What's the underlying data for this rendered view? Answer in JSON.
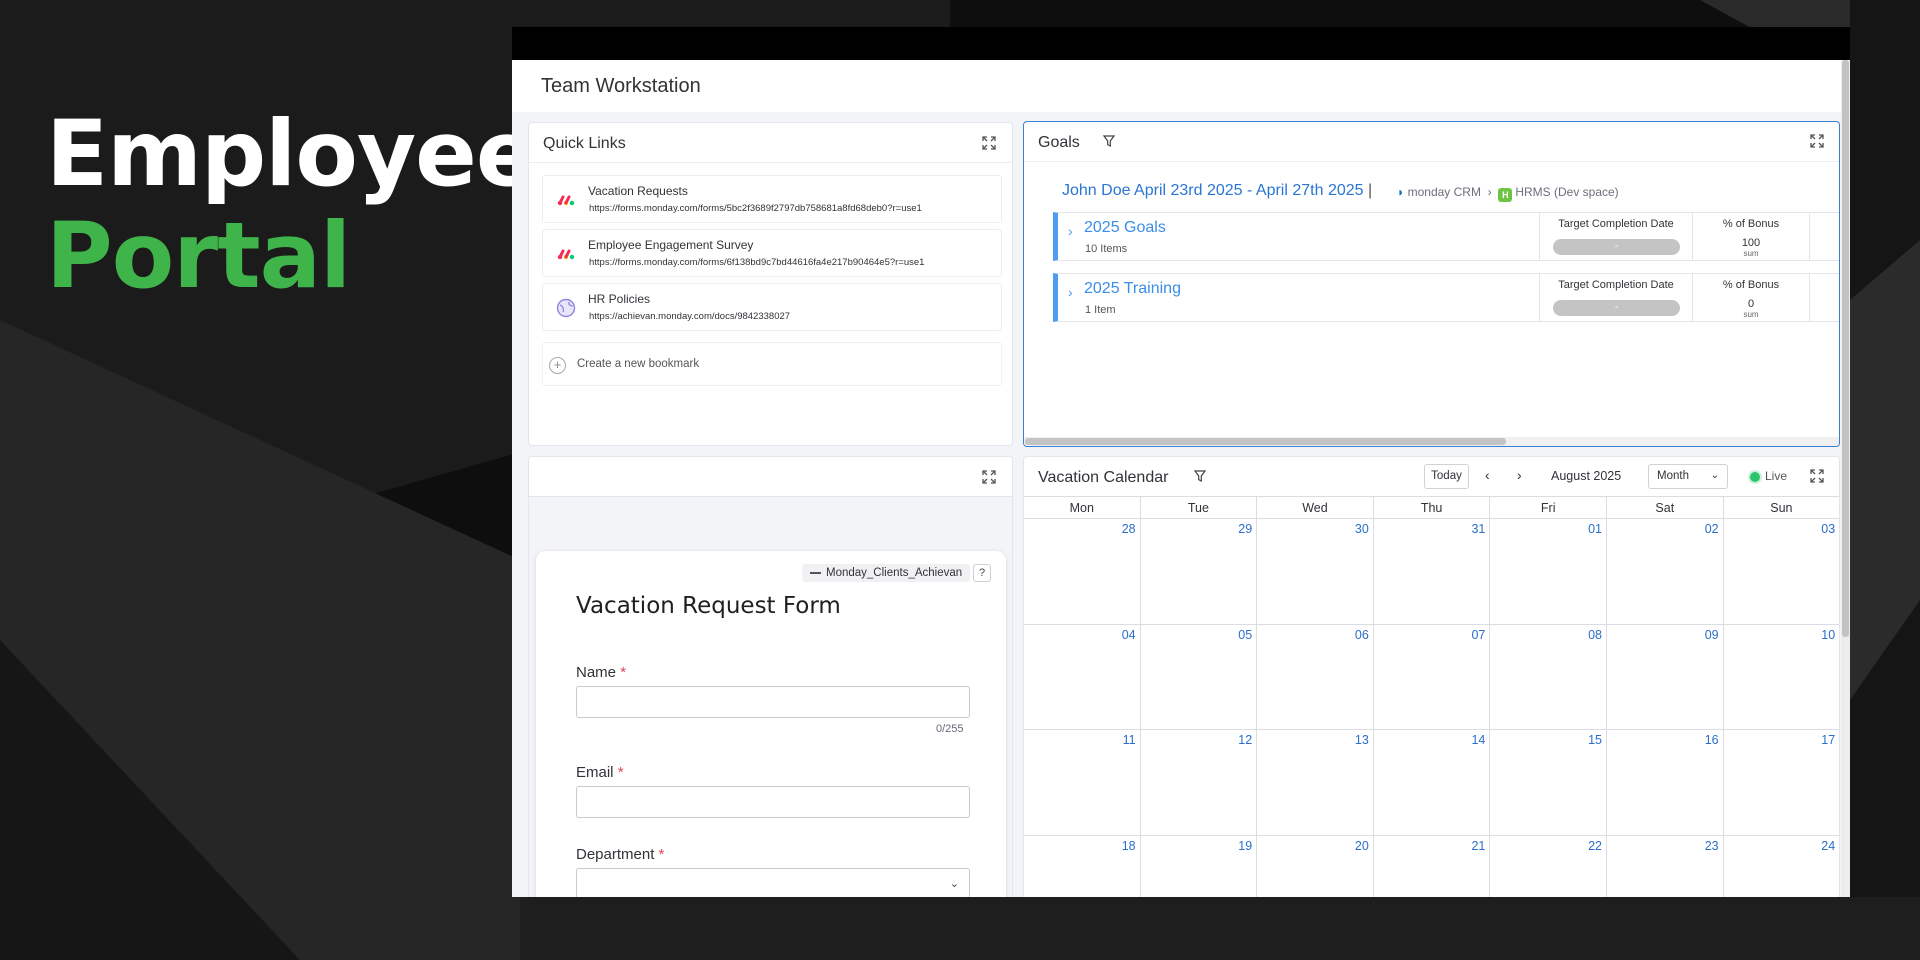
{
  "hero": {
    "line1": "Employee",
    "line2": "Portal"
  },
  "app": {
    "title": "Team Workstation"
  },
  "quick_links": {
    "title": "Quick Links",
    "items": [
      {
        "name": "Vacation Requests",
        "url": "https://forms.monday.com/forms/5bc2f3689f2797db758681a8fd68deb0?r=use1",
        "icon": "monday-logo-icon"
      },
      {
        "name": "Employee Engagement Survey",
        "url": "https://forms.monday.com/forms/6f138bd9c7bd44616fa4e217b90464e5?r=use1",
        "icon": "monday-logo-icon"
      },
      {
        "name": "HR Policies",
        "url": "https://achievan.monday.com/docs/9842338027",
        "icon": "globe-icon"
      }
    ],
    "create_label": "Create a new bookmark"
  },
  "goals": {
    "title": "Goals",
    "header": "John Doe April 23rd 2025 - April 27th 2025",
    "separator": "|",
    "breadcrumb": {
      "crm": "monday CRM",
      "space_badge": "H",
      "space": "HRMS (Dev space)"
    },
    "groups": [
      {
        "name": "2025 Goals",
        "count": "10 Items",
        "col1_header": "Target Completion Date",
        "col1_value": "-",
        "col2_header": "% of Bonus",
        "col2_value": "100",
        "col2_sub": "sum"
      },
      {
        "name": "2025 Training",
        "count": "1 Item",
        "col1_header": "Target Completion Date",
        "col1_value": "-",
        "col2_header": "% of Bonus",
        "col2_value": "0",
        "col2_sub": "sum"
      }
    ]
  },
  "form": {
    "workspace_tag": "Monday_Clients_Achievan",
    "help": "?",
    "title": "Vacation Request Form",
    "name_label": "Name",
    "name_counter": "0/255",
    "email_label": "Email",
    "department_label": "Department",
    "required_mark": "*"
  },
  "calendar": {
    "title": "Vacation Calendar",
    "today": "Today",
    "prev": "‹",
    "next": "›",
    "month": "August 2025",
    "view": "Month",
    "live": "Live",
    "days": [
      "Mon",
      "Tue",
      "Wed",
      "Thu",
      "Fri",
      "Sat",
      "Sun"
    ],
    "weeks": [
      [
        "28",
        "29",
        "30",
        "31",
        "01",
        "02",
        "03"
      ],
      [
        "04",
        "05",
        "06",
        "07",
        "08",
        "09",
        "10"
      ],
      [
        "11",
        "12",
        "13",
        "14",
        "15",
        "16",
        "17"
      ],
      [
        "18",
        "19",
        "20",
        "21",
        "22",
        "23",
        "24"
      ]
    ]
  },
  "colors": {
    "accent": "#3fb44a",
    "link": "#2a76d4",
    "group_bar": "#4e9bf0",
    "live": "#2bc36b",
    "required": "#e2445c"
  }
}
